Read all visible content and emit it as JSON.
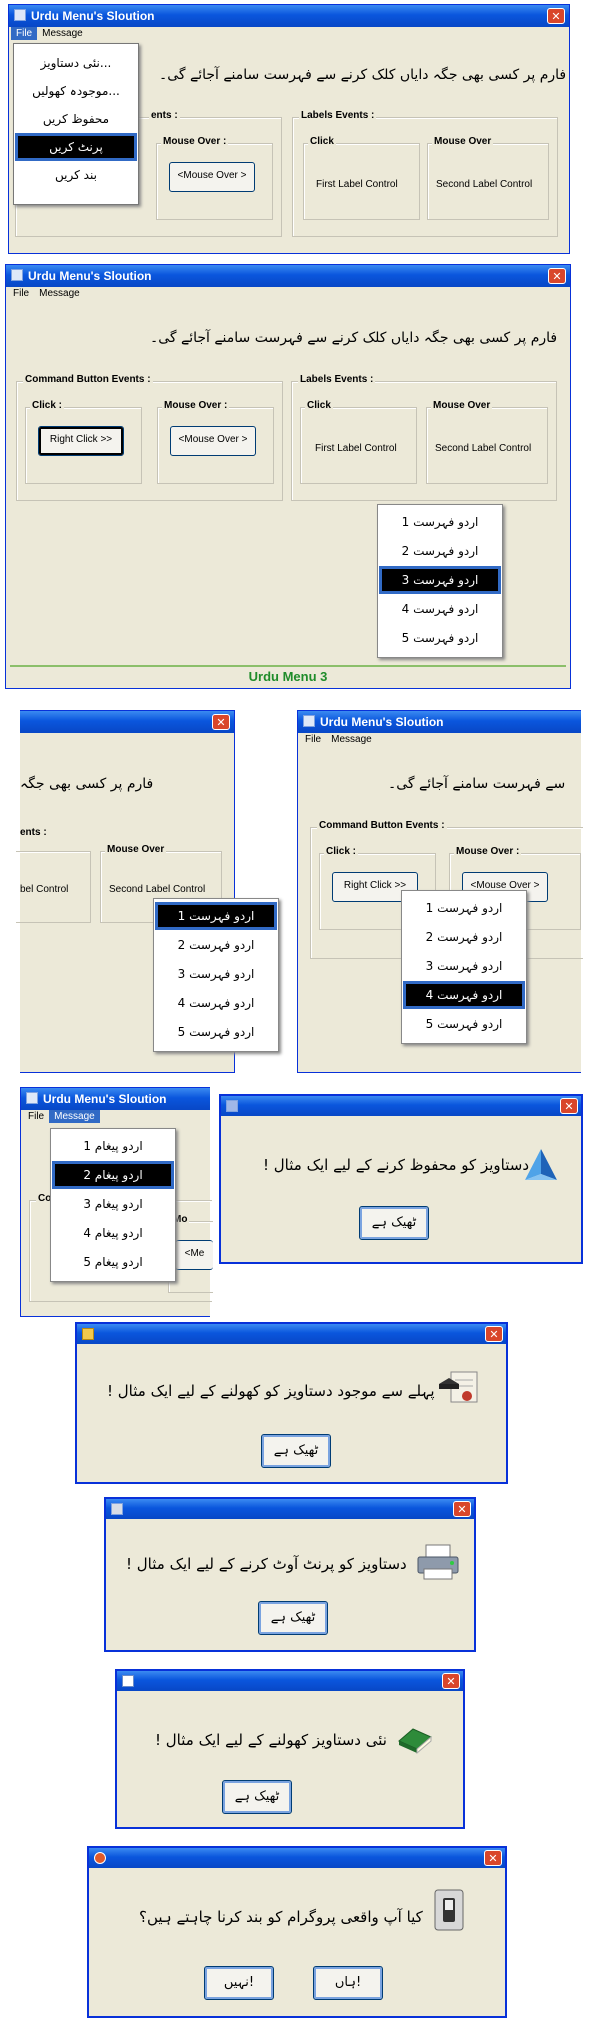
{
  "app_title": "Urdu Menu's Sloution",
  "menu": {
    "file": "File",
    "message": "Message"
  },
  "banner_text": "فارم پر کسی بھی جگہ دایاں کلک کرنے سے فہرست سامنے آجائے گی۔",
  "command_events_label": "Command Button Events :",
  "labels_events_label": "Labels Events :",
  "click_label": "Click :",
  "mouse_over_label": "Mouse Over :",
  "click_label_plain": "Click",
  "mouse_over_plain": "Mouse Over",
  "right_click_button": "Right Click >>",
  "mouse_over_button": "<Mouse Over >",
  "first_label_control": "First Label Control",
  "second_label_control": "Second Label Control",
  "fragments": {
    "events_cut": "ents :",
    "events_cut2": "vents :",
    "label_control_cut": "bel Control",
    "banner_cut_right": "فارم پر کسی بھی جگہ",
    "banner_cut_left": "سے فہرست سامنے آجائے گی۔",
    "co_cut": "Co",
    "mo_cut": "Mo",
    "me_cut": "<Me"
  },
  "file_menu_items": [
    "نئی دستاویز...",
    "موجودہ کھولیں...",
    "محفوظ کریں",
    "پرنٹ کریں",
    "بند کریں"
  ],
  "file_menu_selected": 3,
  "context_menu_items": [
    "اردو فہرست 1",
    "اردو فہرست 2",
    "اردو فہرست 3",
    "اردو فہرست 4",
    "اردو فہرست 5"
  ],
  "message_menu_items": [
    "اردو پیغام 1",
    "اردو پیغام 2",
    "اردو پیغام 3",
    "اردو پیغام 4",
    "اردو پیغام 5"
  ],
  "status_text": "Urdu Menu 3",
  "dialogs": {
    "save_msg": "دستاویز کو محفوظ کرنے کے لیے ایک مثال !",
    "open_msg": "پہلے سے موجود دستاویز کو کھولنے کے لیے ایک مثال !",
    "print_msg": "دستاویز کو پرنٹ آوٹ کرنے کے لیے ایک مثال !",
    "new_msg": "نئی دستاویز کھولنے کے لیے ایک مثال !",
    "exit_msg": "کیا آپ واقعی پروگرام کو بند کرنا چاہتے ہیں؟",
    "ok_label": "ٹھیک ہے",
    "no_label": "نہیں!",
    "yes_label": "ہاں!"
  },
  "colors": {
    "title_blue": "#0a56dd",
    "selection_blue": "#316ac5",
    "close_red": "#d9462b",
    "status_green": "#1f8c2a"
  }
}
